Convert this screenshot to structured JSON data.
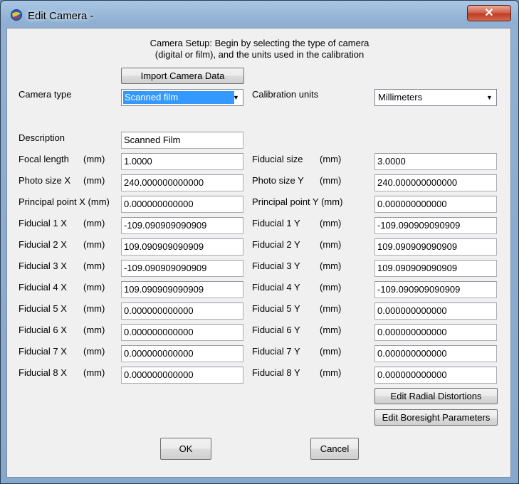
{
  "window": {
    "title": "Edit Camera -",
    "close_glyph": "✕"
  },
  "header": {
    "line1": "Camera Setup:  Begin by selecting the type of camera",
    "line2": "(digital or film), and the units used in the calibration"
  },
  "import_button": "Import Camera Data",
  "camera_type": {
    "label": "Camera type",
    "value": "Scanned film"
  },
  "calibration_units": {
    "label": "Calibration units",
    "value": "Millimeters"
  },
  "description": {
    "label": "Description",
    "value": "Scanned Film"
  },
  "left_rows": [
    {
      "label": "Focal length",
      "unit": "(mm)",
      "value": "1.0000"
    },
    {
      "label": "Photo size X",
      "unit": "(mm)",
      "value": "240.000000000000"
    },
    {
      "label": "Principal point X (mm)",
      "unit": "",
      "value": "0.000000000000"
    },
    {
      "label": "Fiducial 1 X",
      "unit": "(mm)",
      "value": "-109.090909090909"
    },
    {
      "label": "Fiducial 2 X",
      "unit": "(mm)",
      "value": "109.090909090909"
    },
    {
      "label": "Fiducial 3 X",
      "unit": "(mm)",
      "value": "-109.090909090909"
    },
    {
      "label": "Fiducial 4 X",
      "unit": "(mm)",
      "value": "109.090909090909"
    },
    {
      "label": "Fiducial 5 X",
      "unit": "(mm)",
      "value": "0.000000000000"
    },
    {
      "label": "Fiducial 6 X",
      "unit": "(mm)",
      "value": "0.000000000000"
    },
    {
      "label": "Fiducial 7 X",
      "unit": "(mm)",
      "value": "0.000000000000"
    },
    {
      "label": "Fiducial 8 X",
      "unit": "(mm)",
      "value": "0.000000000000"
    }
  ],
  "right_rows": [
    {
      "label": "Fiducial size",
      "unit": "(mm)",
      "value": "3.0000"
    },
    {
      "label": "Photo size Y",
      "unit": "(mm)",
      "value": "240.000000000000"
    },
    {
      "label": "Principal point Y (mm)",
      "unit": "",
      "value": "0.000000000000"
    },
    {
      "label": "Fiducial 1 Y",
      "unit": "(mm)",
      "value": "-109.090909090909"
    },
    {
      "label": "Fiducial 2 Y",
      "unit": "(mm)",
      "value": "109.090909090909"
    },
    {
      "label": "Fiducial 3 Y",
      "unit": "(mm)",
      "value": "109.090909090909"
    },
    {
      "label": "Fiducial 4 Y",
      "unit": "(mm)",
      "value": "-109.090909090909"
    },
    {
      "label": "Fiducial 5 Y",
      "unit": "(mm)",
      "value": "0.000000000000"
    },
    {
      "label": "Fiducial 6 Y",
      "unit": "(mm)",
      "value": "0.000000000000"
    },
    {
      "label": "Fiducial 7 Y",
      "unit": "(mm)",
      "value": "0.000000000000"
    },
    {
      "label": "Fiducial 8 Y",
      "unit": "(mm)",
      "value": "0.000000000000"
    }
  ],
  "buttons": {
    "radial": "Edit Radial Distortions",
    "boresight": "Edit Boresight Parameters",
    "ok": "OK",
    "cancel": "Cancel"
  },
  "colors": {
    "selection": "#3399ff",
    "dialog_bg": "#f0f0f0",
    "frame": "#8fb0d3",
    "close": "#c8452e"
  }
}
